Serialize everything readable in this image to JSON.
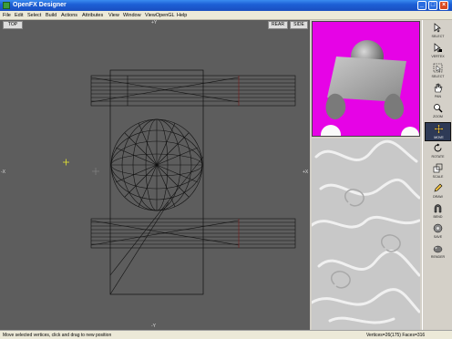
{
  "window": {
    "title": "OpenFX Designer",
    "min_symbol": "_",
    "max_symbol": "□",
    "close_symbol": "×"
  },
  "menu": [
    "File",
    "Edit",
    "Select",
    "Build",
    "Actions",
    "Attributes",
    "View",
    "Window",
    "ViewOpenGL",
    "Help"
  ],
  "viewport": {
    "view_tab": "TOP",
    "rear_tab": "REAR",
    "side_tab": "SIDE",
    "axis_top": "+Y",
    "axis_bottom": "-Y",
    "axis_left": "-X",
    "axis_right": "+X"
  },
  "toolbar": {
    "tools": [
      {
        "label": "SELECT",
        "icon": "select-arrow-icon"
      },
      {
        "label": "VERTEX",
        "icon": "vertex-arrow-icon"
      },
      {
        "label": "SELECT",
        "icon": "select-box-icon"
      },
      {
        "label": "PAN",
        "icon": "pan-hand-icon"
      },
      {
        "label": "ZOOM",
        "icon": "zoom-magnifier-icon"
      },
      {
        "label": "MOVE",
        "icon": "move-cross-icon",
        "active": true
      },
      {
        "label": "ROTATE",
        "icon": "rotate-icon"
      },
      {
        "label": "SCALE",
        "icon": "scale-icon"
      },
      {
        "label": "DRAW",
        "icon": "draw-pencil-icon"
      },
      {
        "label": "BEND",
        "icon": "bend-magnet-icon"
      },
      {
        "label": "SAVE",
        "icon": "save-icon"
      },
      {
        "label": "RENDER",
        "icon": "render-teapot-icon"
      }
    ]
  },
  "status": {
    "message": "Move selected vertices, click and drag to new position",
    "counts": "Vertices=26(175) Faces=316"
  },
  "colors": {
    "title_bar": "#1d5fd6",
    "viewport_bg": "#5d5d5d",
    "preview_bg": "#e603e6",
    "active_tool": "#2e3a56"
  }
}
